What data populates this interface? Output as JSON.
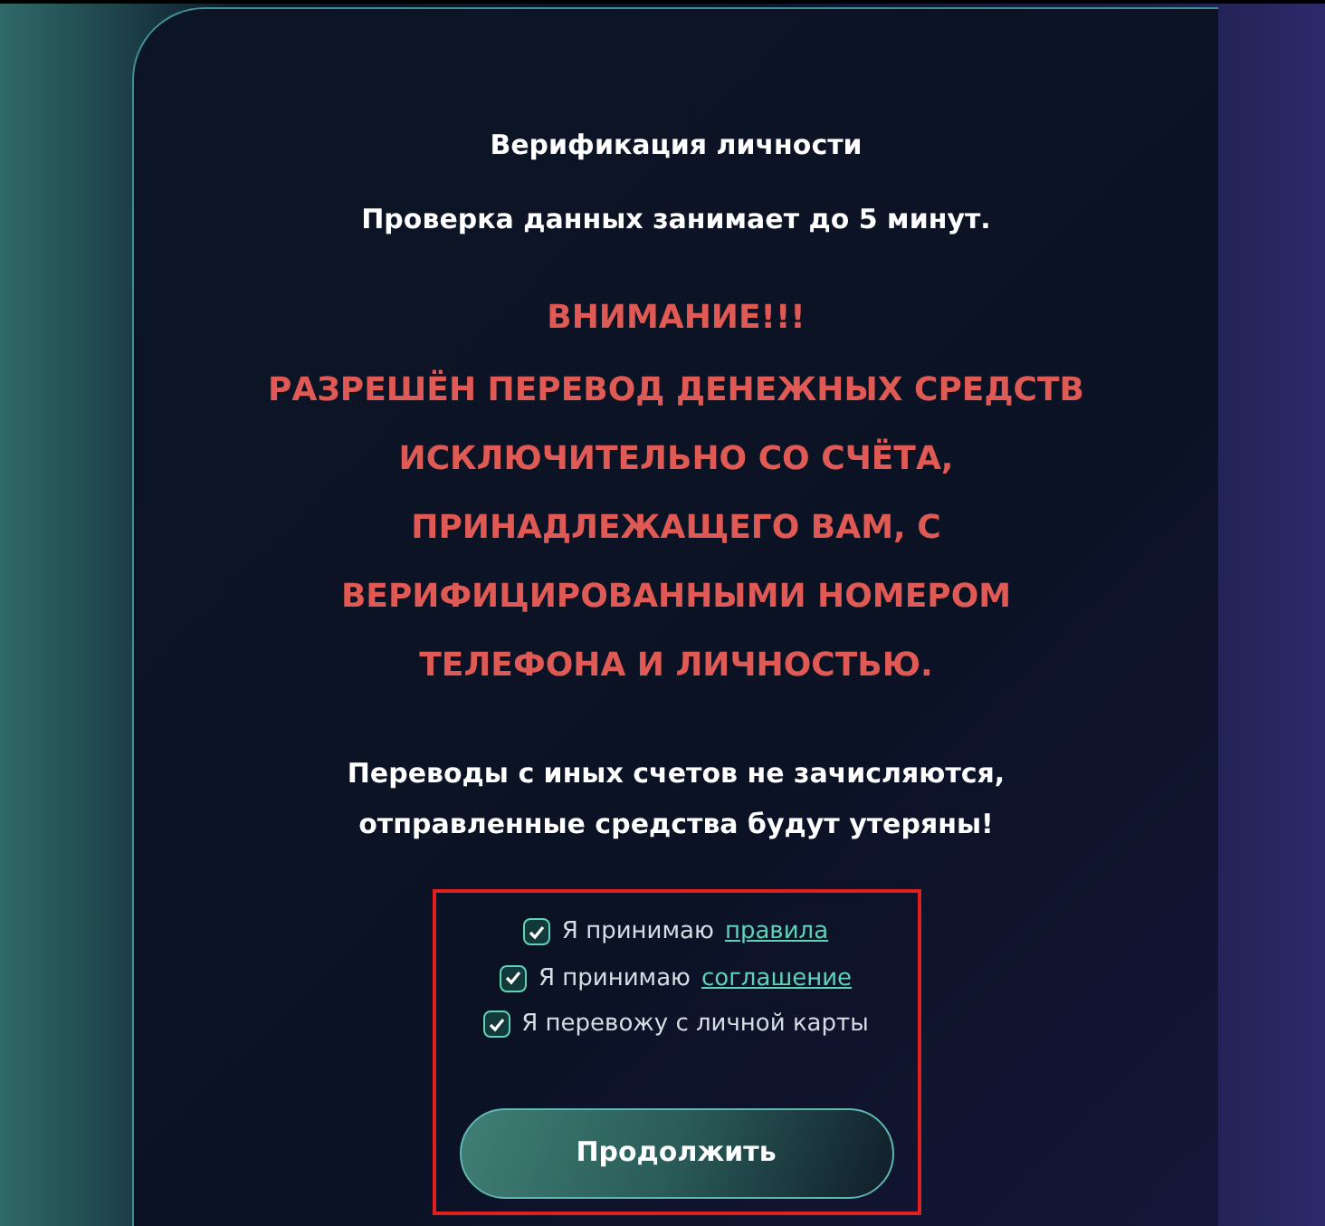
{
  "title": "Верификация личности",
  "subtitle": "Проверка данных занимает до 5 минут.",
  "warning_heading": "ВНИМАНИЕ!!!",
  "warning_text": "РАЗРЕШЁН ПЕРЕВОД ДЕНЕЖНЫХ СРЕДСТВ ИСКЛЮЧИТЕЛЬНО СО СЧЁТА, ПРИНАДЛЕЖАЩЕГО ВАМ, С ВЕРИФИЦИРОВАННЫМИ НОМЕРОМ ТЕЛЕФОНА И ЛИЧНОСТЬЮ.",
  "notice": "Переводы с иных счетов не зачисляются, отправленные средства будут утеряны!",
  "agreements": [
    {
      "text": "Я принимаю",
      "link": "правила",
      "checked": true
    },
    {
      "text": "Я принимаю",
      "link": "соглашение",
      "checked": true
    },
    {
      "text": "Я перевожу с личной карты",
      "checked": true
    }
  ],
  "continue_button": "Продолжить"
}
